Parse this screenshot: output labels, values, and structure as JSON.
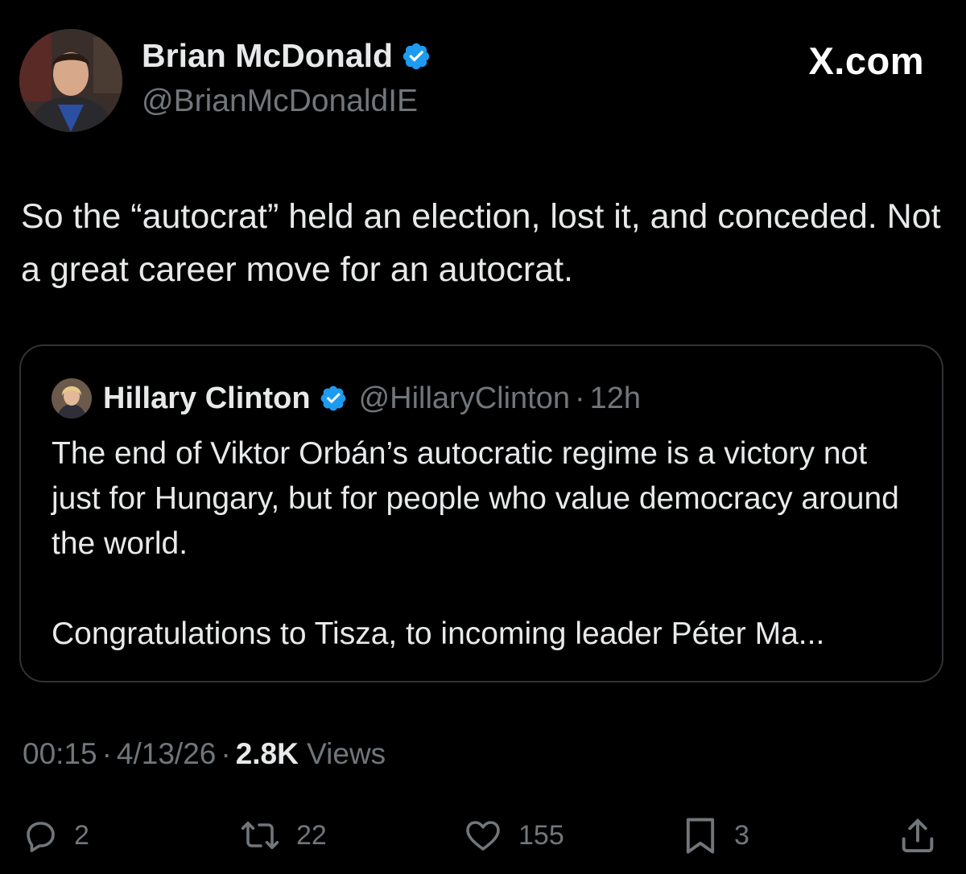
{
  "post": {
    "author_name": "Brian McDonald",
    "author_handle": "@BrianMcDonaldIE",
    "brand": "X.com",
    "text": "So the “autocrat” held an election, lost it, and conceded. Not a great career move for an autocrat.",
    "verified_color": "#1d9bf0"
  },
  "quote": {
    "author_name": "Hillary Clinton",
    "author_handle": "@HillaryClinton",
    "separator": "·",
    "time": "12h",
    "paragraph_1": "The end of Viktor Orbán’s autocratic regime is a victory not just for Hungary, but for people who value democracy around the world.",
    "paragraph_2": "Congratulations to Tisza, to incoming leader Péter Ma..."
  },
  "meta": {
    "time": "00:15",
    "separator": "·",
    "date": "4/13/26",
    "views_count": "2.8K",
    "views_label": "Views"
  },
  "actions": {
    "replies": "2",
    "reposts": "22",
    "likes": "155",
    "bookmarks": "3",
    "icons": [
      "reply-icon",
      "repost-icon",
      "like-icon",
      "bookmark-icon",
      "share-icon"
    ]
  }
}
